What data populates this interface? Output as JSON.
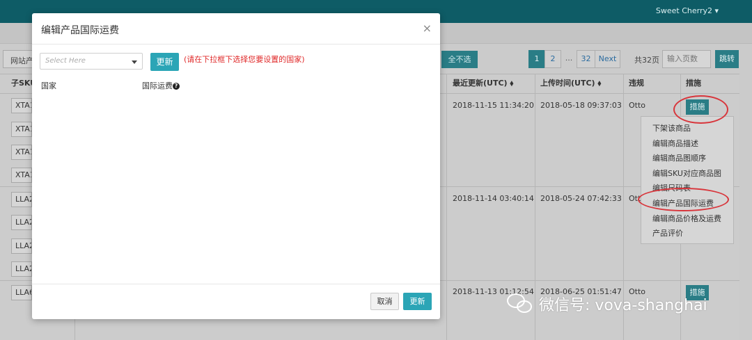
{
  "header": {
    "user_menu": "Sweet Cherry2 ▾"
  },
  "toolbar": {
    "site_filter": "网站产品",
    "deselect_all": "全不选",
    "pager": {
      "pages": [
        "1",
        "2",
        "...",
        "32"
      ],
      "next": "Next",
      "current": "1"
    },
    "total_label": "共32页",
    "page_input_placeholder": "输入页数",
    "jump_label": "跳转"
  },
  "table": {
    "columns": {
      "sku": "子SKU",
      "last_update": "最近更新(UTC) ⬧",
      "upload_time": "上传时间(UTC) ⬧",
      "violation": "违规",
      "actions": "措施"
    },
    "skus": [
      "XTA1",
      "XTA1",
      "XTA1",
      "XTA1",
      "LLA2",
      "LLA2",
      "LLA2",
      "LLA2",
      "LLA6"
    ],
    "rows": [
      {
        "last_update": "2018-11-15 11:34:20",
        "upload_time": "2018-05-18 09:37:03",
        "violation": "Otto",
        "action": "措施"
      },
      {
        "last_update": "2018-11-14 03:40:14",
        "upload_time": "2018-05-24 07:42:33",
        "violation": "Otto",
        "action": ""
      },
      {
        "last_update": "2018-11-13 01:12:54",
        "upload_time": "2018-06-25 01:51:47",
        "violation": "Otto",
        "action": "措施"
      }
    ]
  },
  "action_menu": {
    "items": [
      "下架该商品",
      "编辑商品描述",
      "编辑商品图顺序",
      "编辑SKU对应商品图",
      "编辑尺码表",
      "编辑产品国际运费",
      "编辑商品价格及运费",
      "产品评价"
    ]
  },
  "modal": {
    "title": "编辑产品国际运费",
    "close": "×",
    "select_placeholder": "Select Here",
    "update_label": "更新",
    "hint": "(请在下拉框下选择您要设置的国家)",
    "col_country": "国家",
    "col_shipping": "国际运费",
    "cancel_label": "取消",
    "confirm_label": "更新"
  },
  "watermark": {
    "text": "微信号: vova-shanghai"
  },
  "colors": {
    "topbar": "#0e5c66",
    "accent": "#2ba5b6",
    "highlight": "#d8353b",
    "hint": "#e02a2a"
  }
}
